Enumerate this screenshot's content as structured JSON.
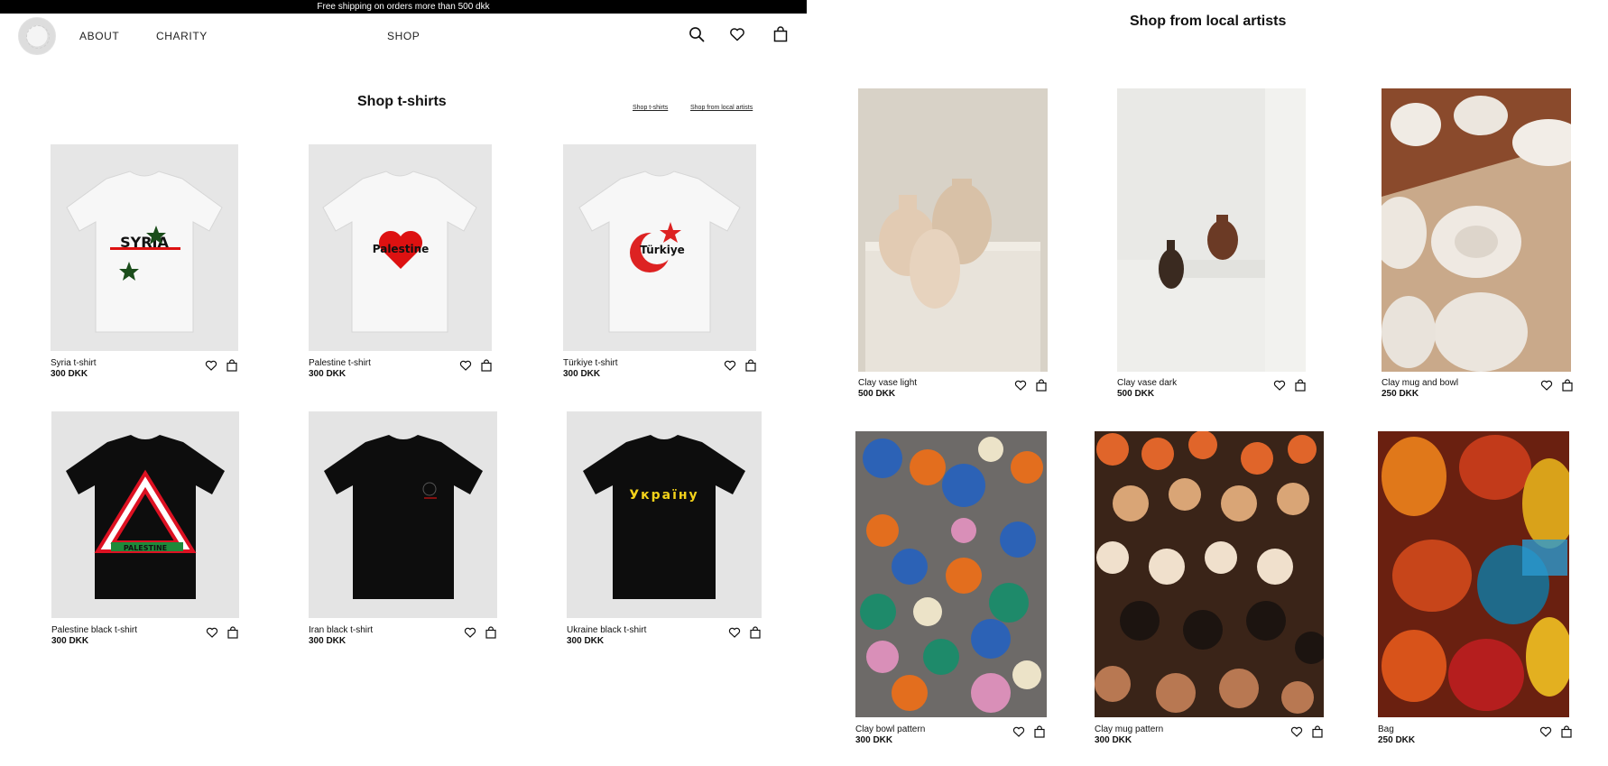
{
  "promo_bar": {
    "text": "Free shipping on orders more than 500 dkk"
  },
  "header": {
    "nav": {
      "about": "ABOUT",
      "charity": "CHARITY",
      "shop": "SHOP"
    },
    "icons": [
      "search-icon",
      "heart-icon",
      "bag-icon"
    ]
  },
  "tshirts": {
    "title": "Shop t-shirts",
    "sub_links": [
      "Shop t-shirts",
      "Shop from local artists"
    ],
    "products": [
      {
        "name": "Syria t-shirt",
        "price": "300 DKK",
        "shirt_color": "white",
        "print": "SYRIA"
      },
      {
        "name": "Palestine t-shirt",
        "price": "300 DKK",
        "shirt_color": "white",
        "print": "Palestine"
      },
      {
        "name": "Türkiye t-shirt",
        "price": "300 DKK",
        "shirt_color": "white",
        "print": "Türkiye"
      },
      {
        "name": "Palestine black t-shirt",
        "price": "300 DKK",
        "shirt_color": "black",
        "print": "PALESTINE"
      },
      {
        "name": "Iran black t-shirt",
        "price": "300 DKK",
        "shirt_color": "black",
        "print": ""
      },
      {
        "name": "Ukraine black t-shirt",
        "price": "300 DKK",
        "shirt_color": "black",
        "print": "Україну"
      }
    ]
  },
  "artists": {
    "title": "Shop from local artists",
    "products": [
      {
        "name": "Clay vase light",
        "price": "500 DKK"
      },
      {
        "name": "Clay vase dark",
        "price": "500 DKK"
      },
      {
        "name": "Clay mug and bowl",
        "price": "250 DKK"
      },
      {
        "name": "Clay bowl pattern",
        "price": "300 DKK"
      },
      {
        "name": "Clay mug pattern",
        "price": "300 DKK"
      },
      {
        "name": "Bag",
        "price": "250 DKK"
      }
    ]
  },
  "colors": {
    "promo_bg": "#000000",
    "text": "#111111",
    "photo_bg": "#e6e6e6"
  }
}
